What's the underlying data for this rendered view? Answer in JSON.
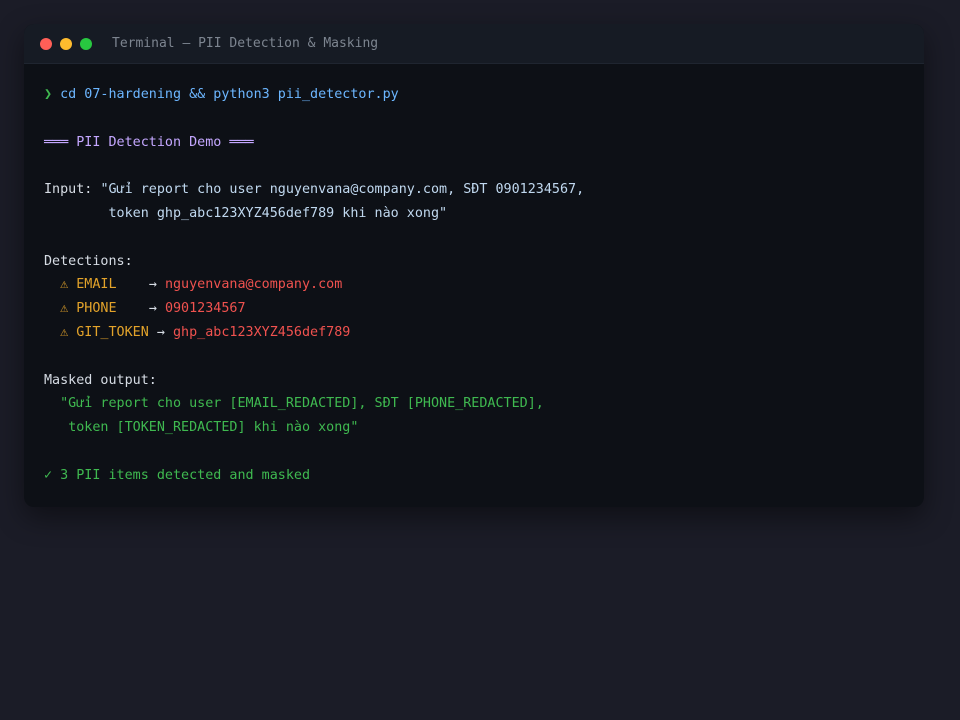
{
  "window": {
    "title": "Terminal — PII Detection & Masking",
    "colors": {
      "close": "#ff5f57",
      "minimize": "#febc2e",
      "maximize": "#28c840"
    }
  },
  "terminal": {
    "prompt_symbol": "❯",
    "command": "cd 07-hardening && python3 pii_detector.py",
    "header": "═══ PII Detection Demo ═══",
    "input_label": "Input: ",
    "input_line1": "\"Gửi report cho user nguyenvana@company.com, SĐT 0901234567,",
    "input_line2": "token ghp_abc123XYZ456def789 khi nào xong\"",
    "detections_label": "Detections:",
    "detections": [
      {
        "icon": "⚠",
        "type": "EMAIL",
        "pad": "    ",
        "arrow": "→",
        "value": "nguyenvana@company.com"
      },
      {
        "icon": "⚠",
        "type": "PHONE",
        "pad": "    ",
        "arrow": "→",
        "value": "0901234567"
      },
      {
        "icon": "⚠",
        "type": "GIT_TOKEN",
        "pad": " ",
        "arrow": "→",
        "value": "ghp_abc123XYZ456def789"
      }
    ],
    "masked_label": "Masked output:",
    "masked_line1": "\"Gửi report cho user [EMAIL_REDACTED], SĐT [PHONE_REDACTED],",
    "masked_line2": "token [TOKEN_REDACTED] khi nào xong\"",
    "summary_icon": "✓",
    "summary_text": "3 PII items detected and masked",
    "colors": {
      "prompt": "#3fb950",
      "command": "#6cb6ff",
      "header": "#c4a7ff",
      "warning": "#e3a32a",
      "pii_value": "#f0524f",
      "masked": "#3fb950"
    }
  }
}
